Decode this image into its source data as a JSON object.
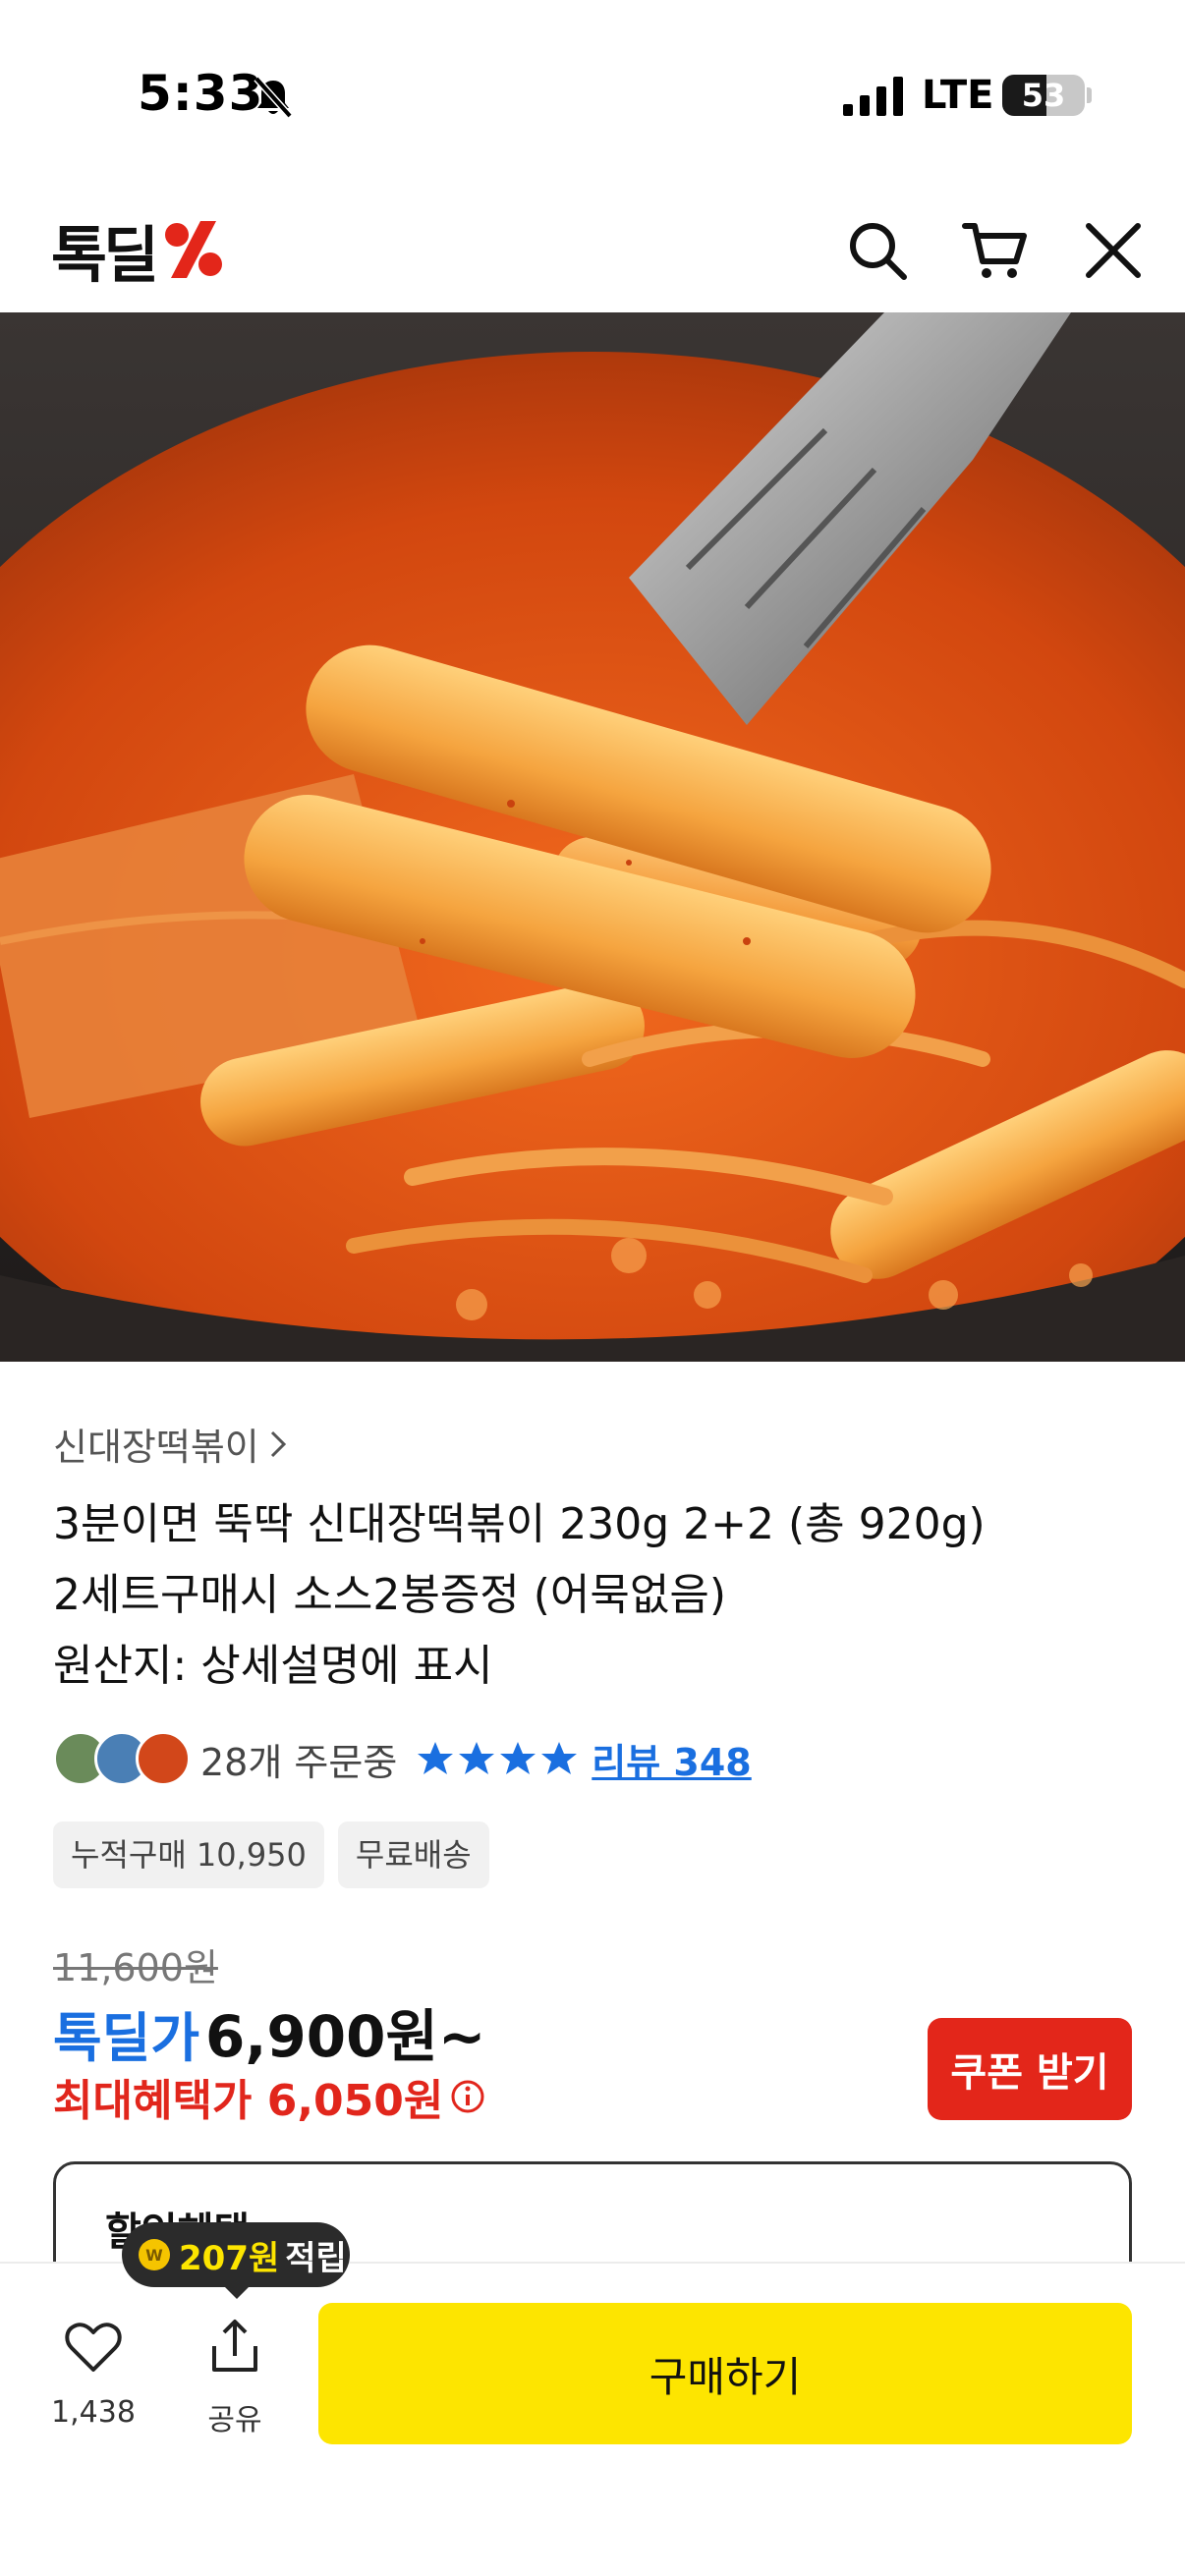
{
  "status_bar": {
    "time": "5:33",
    "network": "LTE",
    "battery": "53",
    "battery_level": 0.53
  },
  "header": {
    "logo_text": "톡딜",
    "icons": [
      "search-icon",
      "cart-icon",
      "close-icon"
    ]
  },
  "gallery": {
    "image": "tteokbokki-photo",
    "dot_count": 6,
    "active_index": 1
  },
  "product": {
    "category": "신대장떡볶이",
    "title_lines": [
      "3분이면 뚝딱 신대장떡볶이 230g 2+2 (총 920g)",
      "2세트구매시 소스2봉증정 (어묵없음)",
      "원산지: 상세설명에 표시"
    ],
    "orders_text": "28개 주문중",
    "rating_stars": 4,
    "review_link": "리뷰 348",
    "tags": [
      "누적구매 10,950",
      "무료배송"
    ],
    "original_price": "11,600원",
    "deal_label": "톡딜가",
    "deal_price": "6,900원~",
    "max_benefit": "최대혜택가 6,050원",
    "coupon_button": "쿠폰 받기",
    "discount_box_title": "할인혜택"
  },
  "bottom_bar": {
    "like_count": "1,438",
    "share_label": "공유",
    "buy_button": "구매하기",
    "tooltip_amount": "207원",
    "tooltip_label": "적립"
  },
  "colors": {
    "brand_red": "#e3261a",
    "accent_blue": "#1a6fe0",
    "buy_yellow": "#fde500"
  }
}
